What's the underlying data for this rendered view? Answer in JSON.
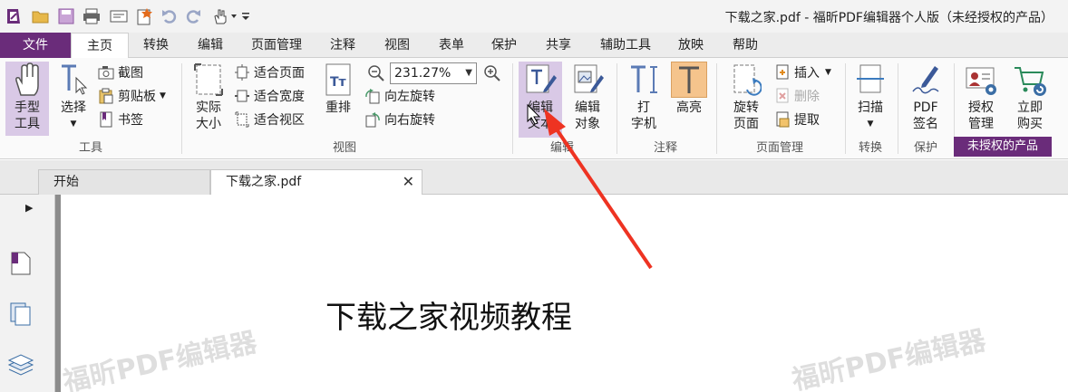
{
  "window": {
    "title": "下载之家.pdf - 福昕PDF编辑器个人版（未经授权的产品）"
  },
  "quick_access": {
    "icons": [
      "app-logo-icon",
      "open-folder-icon",
      "save-icon",
      "print-icon",
      "scan-icon",
      "new-icon",
      "undo-icon",
      "redo-icon",
      "hand-tool-icon",
      "customize-icon"
    ]
  },
  "menu": {
    "tabs": [
      "文件",
      "主页",
      "转换",
      "编辑",
      "页面管理",
      "注释",
      "视图",
      "表单",
      "保护",
      "共享",
      "辅助工具",
      "放映",
      "帮助"
    ],
    "active": "主页"
  },
  "ribbon": {
    "tools": {
      "label": "工具",
      "hand": "手型\n工具",
      "select": "选择",
      "screenshot": "截图",
      "clipboard": "剪贴板",
      "bookmark": "书签"
    },
    "view": {
      "label": "视图",
      "actual_size": "实际\n大小",
      "fit_page": "适合页面",
      "fit_width": "适合宽度",
      "fit_visible": "适合视区",
      "reflow": "重排",
      "zoom_value": "231.27%",
      "rotate_left": "向左旋转",
      "rotate_right": "向右旋转"
    },
    "edit": {
      "label": "编辑",
      "edit_text": "编辑\n文本",
      "edit_object": "编辑\n对象"
    },
    "comment": {
      "label": "注释",
      "typewriter": "打\n字机",
      "highlight": "高亮"
    },
    "pages": {
      "label": "页面管理",
      "rotate_page": "旋转\n页面",
      "insert": "插入",
      "delete": "删除",
      "extract": "提取"
    },
    "convert": {
      "label": "转换",
      "scan": "扫描"
    },
    "protect": {
      "label": "保护",
      "pdf_sign": "PDF\n签名"
    },
    "unlicensed": {
      "label": "未授权的产品",
      "license_manage": "授权\n管理",
      "buy_now": "立即\n购买"
    }
  },
  "doc_tabs": [
    {
      "label": "开始"
    },
    {
      "label": "下载之家.pdf"
    }
  ],
  "document": {
    "heading": "下载之家视频教程",
    "watermark": "福昕PDF编辑器"
  },
  "colors": {
    "brand_purple": "#6a2c7a",
    "highlight_orange": "#f5c48c",
    "active_button": "#d9c9e6",
    "arrow_red": "#ee3322"
  }
}
